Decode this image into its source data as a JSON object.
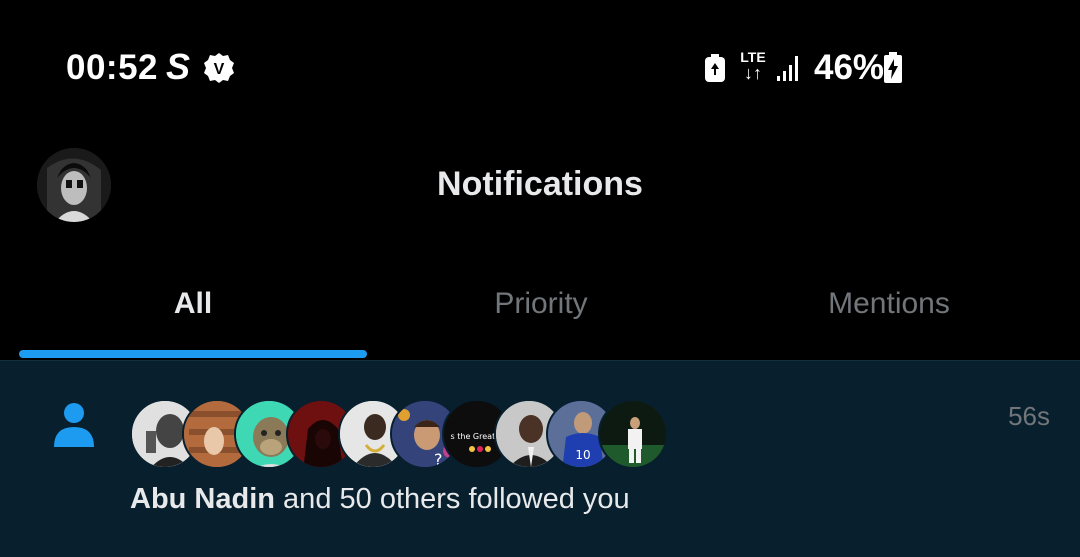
{
  "status_bar": {
    "time": "00:52",
    "carrier_glyph": "S",
    "vpn_badge": "V",
    "network": "LTE",
    "battery_percent": "46%"
  },
  "header": {
    "title": "Notifications"
  },
  "tabs": [
    {
      "label": "All",
      "active": true
    },
    {
      "label": "Priority",
      "active": false
    },
    {
      "label": "Mentions",
      "active": false
    }
  ],
  "notification": {
    "timestamp": "56s",
    "actor_name": "Abu Nadin",
    "message": " and 50 others followed you",
    "avatar_captions": [
      "s the Greatest"
    ],
    "avatar_count": 10
  },
  "colors": {
    "accent": "#1d9bf0",
    "background": "#000000",
    "notification_bg": "#081f2e",
    "muted_text": "#71767b"
  }
}
